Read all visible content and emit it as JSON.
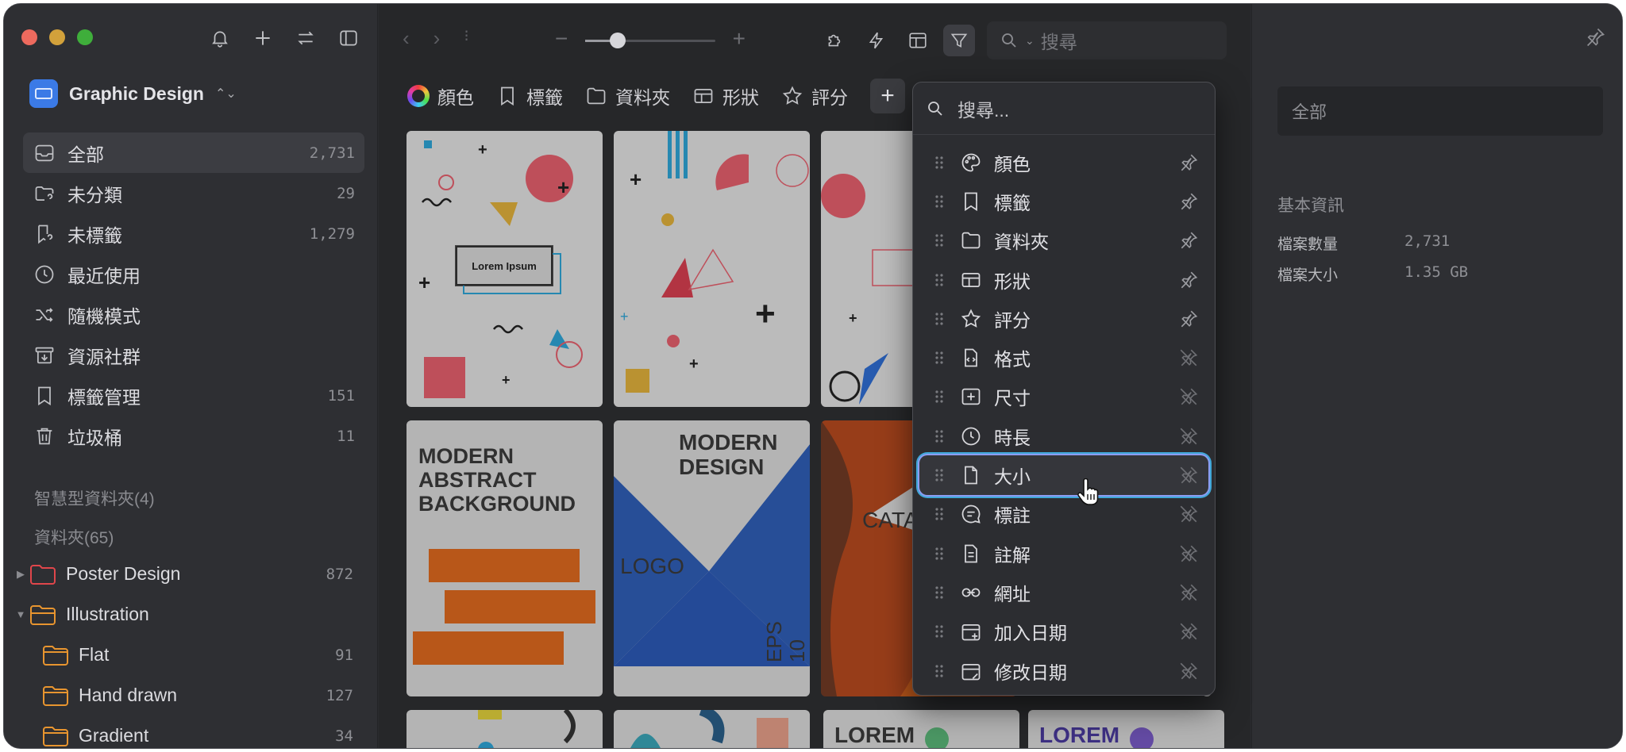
{
  "sidebar": {
    "library_name": "Graphic Design",
    "nav": [
      {
        "label": "全部",
        "count": "2,731",
        "icon": "inbox-icon"
      },
      {
        "label": "未分類",
        "count": "29",
        "icon": "folder-question-icon"
      },
      {
        "label": "未標籤",
        "count": "1,279",
        "icon": "tag-question-icon"
      },
      {
        "label": "最近使用",
        "count": "",
        "icon": "clock-icon"
      },
      {
        "label": "隨機模式",
        "count": "",
        "icon": "shuffle-icon"
      },
      {
        "label": "資源社群",
        "count": "",
        "icon": "download-box-icon"
      },
      {
        "label": "標籤管理",
        "count": "151",
        "icon": "bookmark-icon"
      },
      {
        "label": "垃圾桶",
        "count": "11",
        "icon": "trash-icon"
      }
    ],
    "smart_folders_label": "智慧型資料夾(4)",
    "folders_label": "資料夾(65)",
    "folders": [
      {
        "label": "Poster Design",
        "count": "872",
        "color": "#e0464b"
      },
      {
        "label": "Illustration",
        "count": "",
        "color": "#e8952f"
      },
      {
        "label": "Flat",
        "count": "91",
        "color": "#e8952f"
      },
      {
        "label": "Hand drawn",
        "count": "127",
        "color": "#e8952f"
      },
      {
        "label": "Gradient",
        "count": "34",
        "color": "#e8952f"
      }
    ]
  },
  "toolbar": {
    "search_placeholder": "搜尋",
    "zoom_level": 0.25
  },
  "filters": [
    "顏色",
    "標籤",
    "資料夾",
    "形狀",
    "評分"
  ],
  "thumbs": {
    "lorem": "Lorem Ipsum",
    "modern_abstract": "MODERN\nABSTRACT\nBACKGROUND",
    "modern_design": "MODERN\nDESIGN",
    "logo": "LOGO",
    "eps": "EPS 10",
    "cata": "CATA",
    "lorem_ipsum_big": "LOREM\nIPSUM"
  },
  "dropdown": {
    "search_placeholder": "搜尋...",
    "items": [
      {
        "label": "顏色",
        "icon": "palette-icon",
        "pinned": true
      },
      {
        "label": "標籤",
        "icon": "bookmark-icon",
        "pinned": true
      },
      {
        "label": "資料夾",
        "icon": "folder-icon",
        "pinned": true
      },
      {
        "label": "形狀",
        "icon": "shape-icon",
        "pinned": true
      },
      {
        "label": "評分",
        "icon": "star-icon",
        "pinned": true
      },
      {
        "label": "格式",
        "icon": "code-file-icon",
        "pinned": false
      },
      {
        "label": "尺寸",
        "icon": "dimension-icon",
        "pinned": false
      },
      {
        "label": "時長",
        "icon": "clock-icon",
        "pinned": false
      },
      {
        "label": "大小",
        "icon": "file-icon",
        "pinned": false
      },
      {
        "label": "標註",
        "icon": "annotation-icon",
        "pinned": false
      },
      {
        "label": "註解",
        "icon": "note-icon",
        "pinned": false
      },
      {
        "label": "網址",
        "icon": "link-icon",
        "pinned": false
      },
      {
        "label": "加入日期",
        "icon": "calendar-add-icon",
        "pinned": false
      },
      {
        "label": "修改日期",
        "icon": "calendar-edit-icon",
        "pinned": false
      }
    ],
    "hovered_index": 8
  },
  "right_panel": {
    "name_placeholder": "全部",
    "info_heading": "基本資訊",
    "rows": [
      {
        "key": "檔案數量",
        "value": "2,731"
      },
      {
        "key": "檔案大小",
        "value": "1.35 GB"
      }
    ]
  },
  "colors": {
    "accent": "#3b7ae6",
    "hover_ring": "#8c9cf2"
  }
}
